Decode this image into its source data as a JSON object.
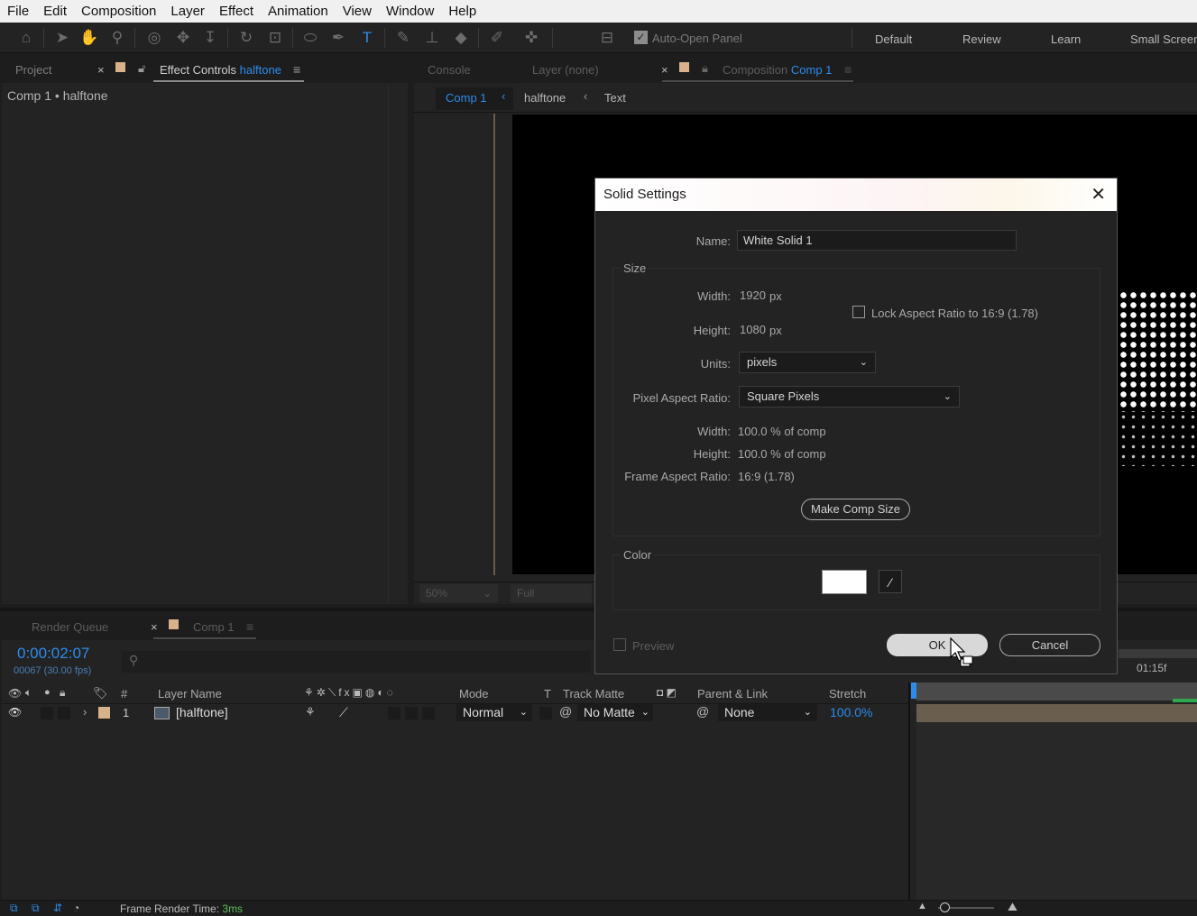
{
  "menu": [
    "File",
    "Edit",
    "Composition",
    "Layer",
    "Effect",
    "Animation",
    "View",
    "Window",
    "Help"
  ],
  "toolbar": {
    "auto_open_panel": "Auto-Open Panel"
  },
  "workspaces": [
    "Default",
    "Review",
    "Learn",
    "Small Screen"
  ],
  "left_panel": {
    "tab_project": "Project",
    "tab_effect_controls": "Effect Controls",
    "effect_target": "halftone",
    "breadcrumb": "Comp 1 • halftone"
  },
  "viewer": {
    "tab_console": "Console",
    "tab_layer": "Layer (none)",
    "tab_composition": "Composition",
    "comp_name": "Comp 1",
    "crumbs": [
      "Comp 1",
      "halftone",
      "Text"
    ],
    "zoom": "50%",
    "resolution": "Full"
  },
  "dialog": {
    "title": "Solid Settings",
    "name_label": "Name:",
    "name_value": "White Solid 1",
    "size_group": "Size",
    "width_label": "Width:",
    "width_value": "1920",
    "height_label": "Height:",
    "height_value": "1080",
    "px": "px",
    "lock_aspect": "Lock Aspect Ratio to 16:9 (1.78)",
    "units_label": "Units:",
    "units_value": "pixels",
    "par_label": "Pixel Aspect Ratio:",
    "par_value": "Square Pixels",
    "width_pct_label": "Width:",
    "width_pct": "100.0 % of comp",
    "height_pct_label": "Height:",
    "height_pct": "100.0 % of comp",
    "far_label": "Frame Aspect Ratio:",
    "far_value": "16:9 (1.78)",
    "make_comp_size": "Make Comp Size",
    "color_group": "Color",
    "color_value": "#ffffff",
    "preview": "Preview",
    "ok": "OK",
    "cancel": "Cancel"
  },
  "timeline": {
    "tab_render_queue": "Render Queue",
    "tab_comp": "Comp 1",
    "timecode": "0:00:02:07",
    "frames": "00067 (30.00 fps)",
    "ruler_label": "01:15f",
    "columns": {
      "num": "#",
      "layer_name": "Layer Name",
      "mode": "Mode",
      "t": "T",
      "track_matte": "Track Matte",
      "parent": "Parent & Link",
      "stretch": "Stretch"
    },
    "layers": [
      {
        "num": "1",
        "name": "[halftone]",
        "mode": "Normal",
        "matte": "No Matte",
        "parent": "None",
        "stretch": "100.0%"
      }
    ]
  },
  "status": {
    "render_label": "Frame Render Time:",
    "render_value": "3ms"
  }
}
